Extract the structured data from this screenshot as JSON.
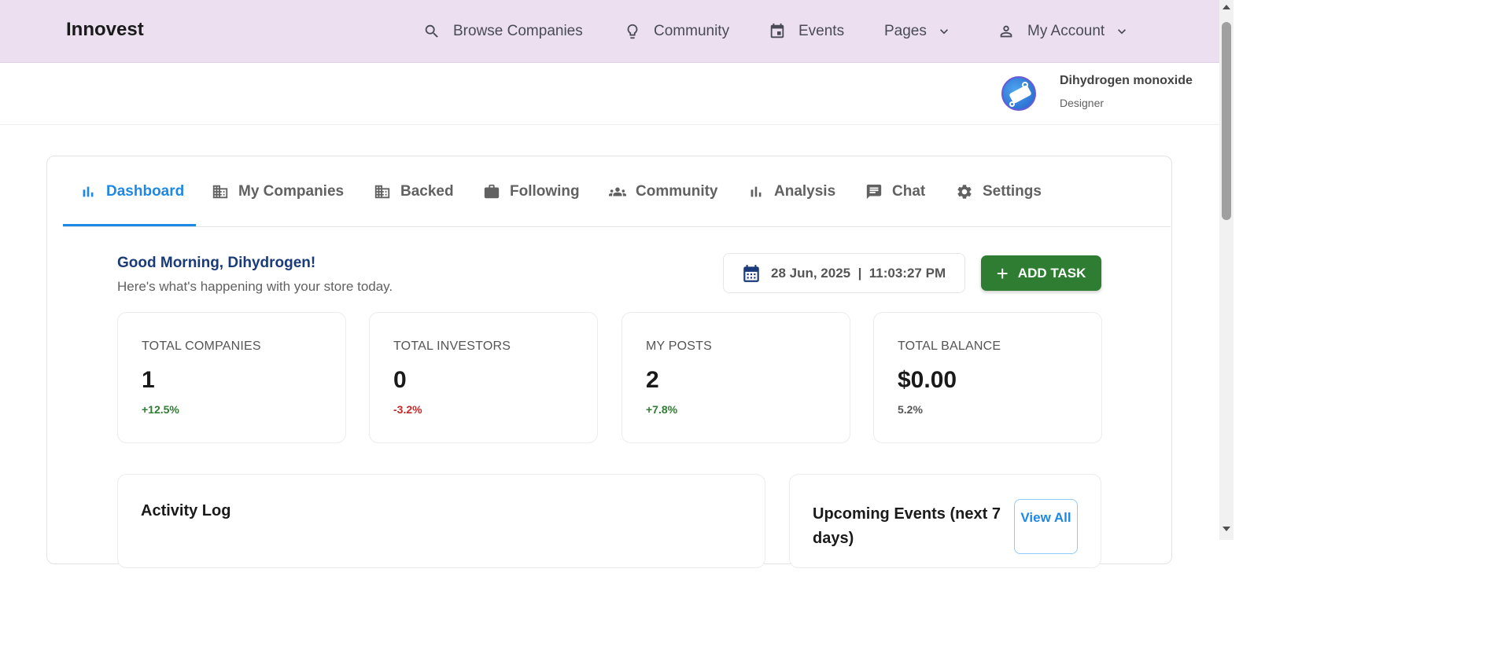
{
  "nav": {
    "brand": "Innovest",
    "items": [
      {
        "label": "Browse Companies",
        "icon": "search-icon"
      },
      {
        "label": "Community",
        "icon": "lightbulb-icon"
      },
      {
        "label": "Events",
        "icon": "calendar-icon"
      },
      {
        "label": "Pages",
        "icon": "chevron-down-icon"
      },
      {
        "label": "My Account",
        "icon": "person-icon"
      }
    ]
  },
  "profile": {
    "name": "Dihydrogen monoxide",
    "role": "Designer"
  },
  "tabs": [
    {
      "label": "Dashboard",
      "icon": "bar-chart-icon",
      "active": true
    },
    {
      "label": "My Companies",
      "icon": "building-icon"
    },
    {
      "label": "Backed",
      "icon": "building-icon"
    },
    {
      "label": "Following",
      "icon": "briefcase-icon"
    },
    {
      "label": "Community",
      "icon": "people-icon"
    },
    {
      "label": "Analysis",
      "icon": "bar-chart-icon"
    },
    {
      "label": "Chat",
      "icon": "chat-icon"
    },
    {
      "label": "Settings",
      "icon": "gear-icon"
    }
  ],
  "header": {
    "greeting": "Good Morning, Dihydrogen!",
    "subtitle": "Here's what's happening with your store today.",
    "datetime": "28 Jun, 2025  |  11:03:27 PM",
    "add_task": "ADD TASK"
  },
  "stats": [
    {
      "label": "TOTAL COMPANIES",
      "value": "1",
      "change": "+12.5%",
      "color": "#2e7d32"
    },
    {
      "label": "TOTAL INVESTORS",
      "value": "0",
      "change": "-3.2%",
      "color": "#c62828"
    },
    {
      "label": "MY POSTS",
      "value": "2",
      "change": "+7.8%",
      "color": "#2e7d32"
    },
    {
      "label": "TOTAL BALANCE",
      "value": "$0.00",
      "change": "5.2%",
      "color": "#555555"
    }
  ],
  "panels": {
    "activity_title": "Activity Log",
    "events_title": "Upcoming Events (next 7 days)",
    "view_all": "View All"
  },
  "colors": {
    "accent": "#1e88e5",
    "nav_bg": "#ebdff0",
    "primary_button": "#2e7d32",
    "greeting": "#1a3a7a"
  }
}
